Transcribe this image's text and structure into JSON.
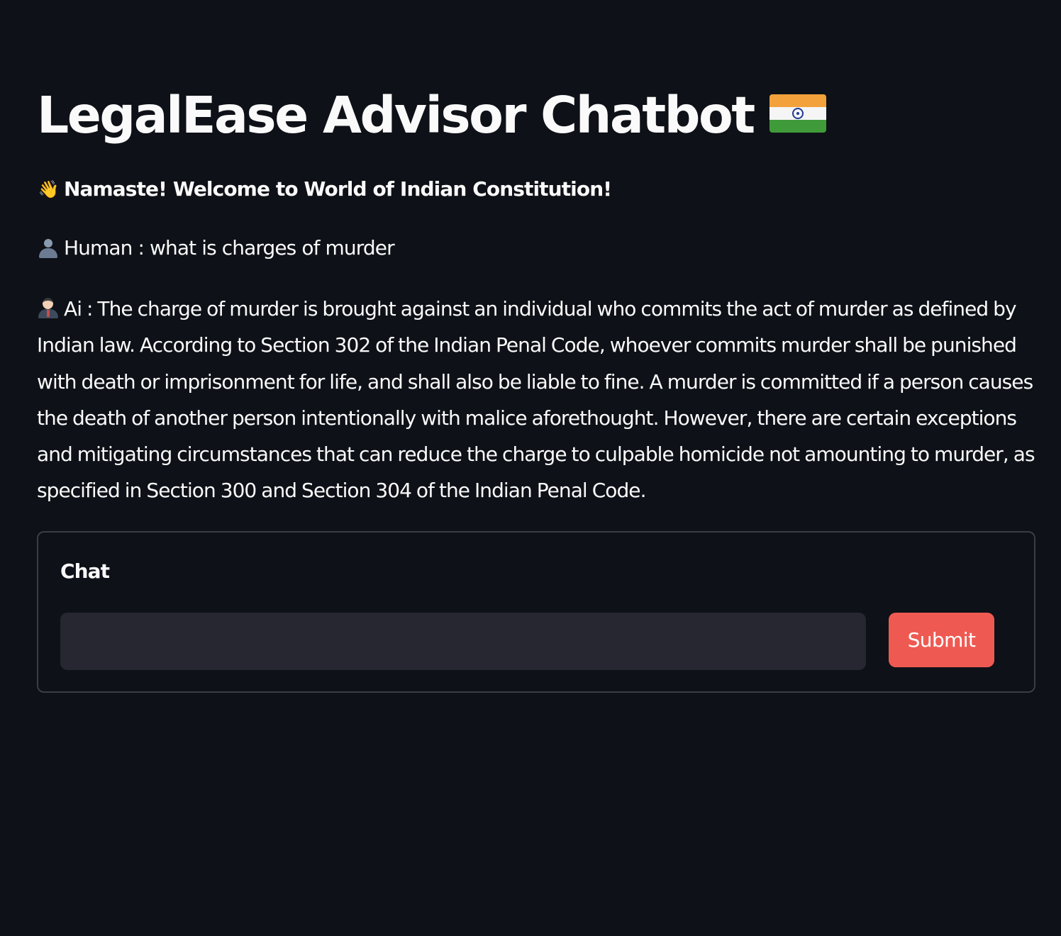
{
  "header": {
    "title": "LegalEase Advisor Chatbot",
    "title_icon": "india-flag-icon"
  },
  "welcome": {
    "icon": "waving-hand-icon",
    "emoji": "👋",
    "text": "Namaste! Welcome to World of Indian Constitution!"
  },
  "conversation": [
    {
      "role_icon": "person-silhouette-icon",
      "text": "Human : what is charges of murder"
    },
    {
      "role_icon": "ai-judge-icon",
      "text": "Ai : The charge of murder is brought against an individual who commits the act of murder as defined by Indian law. According to Section 302 of the Indian Penal Code, whoever commits murder shall be punished with death or imprisonment for life, and shall also be liable to fine. A murder is committed if a person causes the death of another person intentionally with malice aforethought. However, there are certain exceptions and mitigating circumstances that can reduce the charge to culpable homicide not amounting to murder, as specified in Section 300 and Section 304 of the Indian Penal Code."
    }
  ],
  "chat_form": {
    "label": "Chat",
    "input_value": "",
    "submit_label": "Submit"
  },
  "colors": {
    "background": "#0e1117",
    "text": "#fafafa",
    "input_background": "#262730",
    "submit_button": "#ee5a52",
    "form_border": "#3a3d46"
  }
}
